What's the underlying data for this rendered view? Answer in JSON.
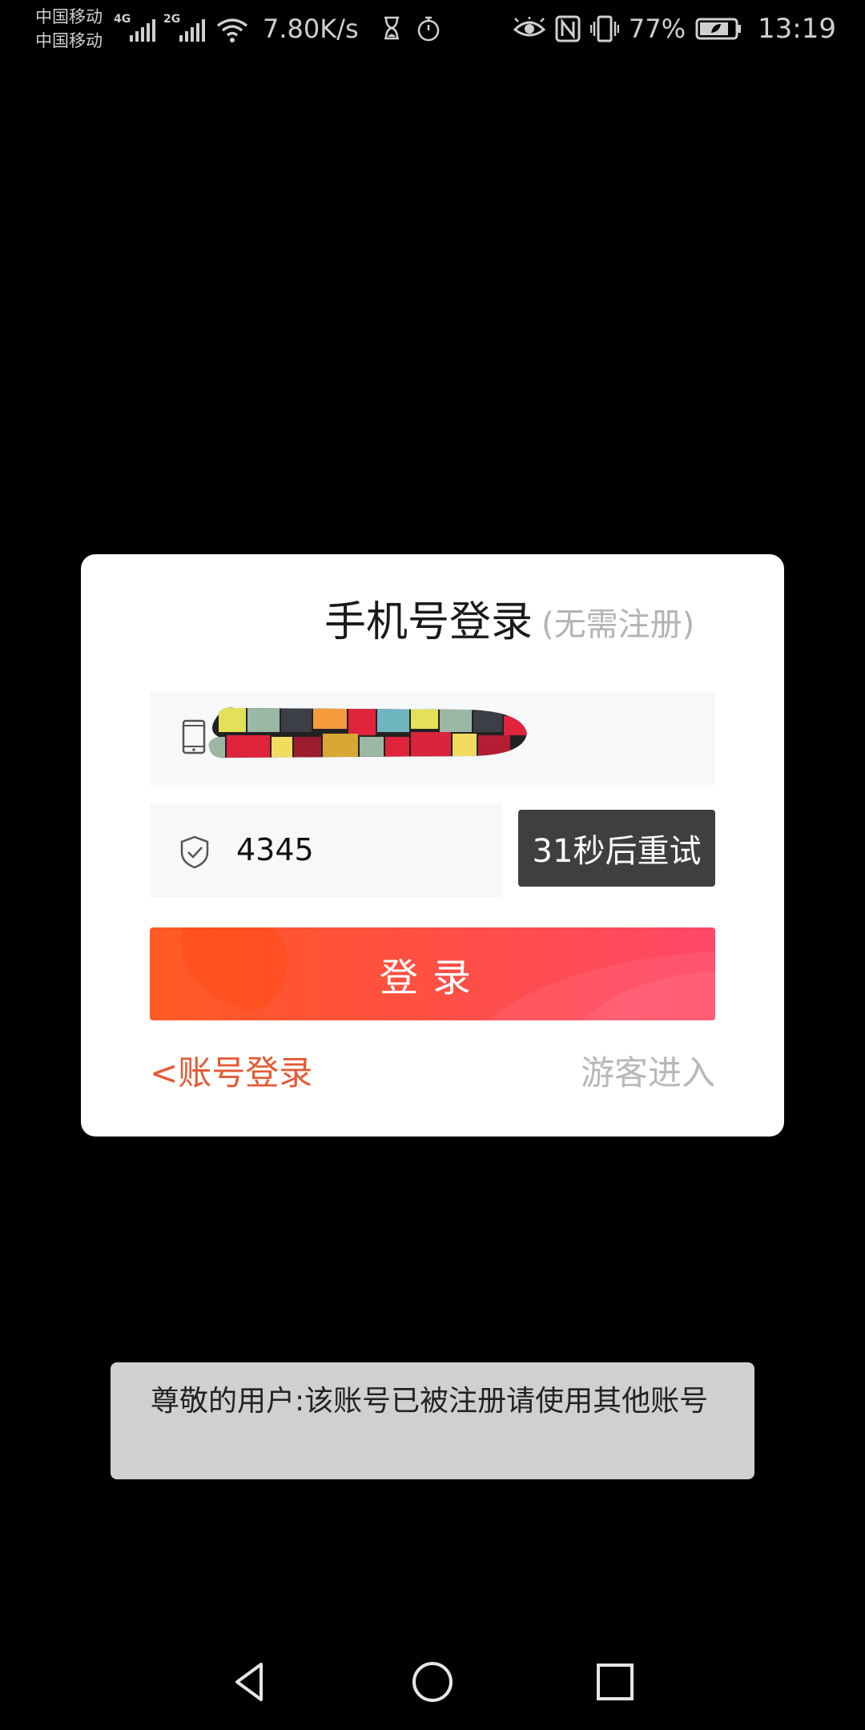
{
  "status_bar": {
    "carrier_1": "中国移动",
    "carrier_2": "中国移动",
    "sim1_network": "4G",
    "sim2_network": "2G",
    "net_speed": "7.80K/s",
    "battery_percent": "77%",
    "time": "13:19",
    "icons": [
      "signal-icon",
      "signal-icon",
      "wifi-icon",
      "hourglass-icon",
      "stopwatch-icon",
      "eye-icon",
      "nfc-icon",
      "vibrate-icon",
      "battery-icon"
    ]
  },
  "dialog": {
    "title": "手机号登录",
    "subtitle": "(无需注册)",
    "phone_field": {
      "icon": "phone-icon",
      "value": ""
    },
    "code_field": {
      "icon": "shield-check-icon",
      "value": "4345"
    },
    "retry_button": "31秒后重试",
    "login_button": "登录",
    "account_login_link": "<账号登录",
    "guest_link": "游客进入"
  },
  "toast": {
    "message": "尊敬的用户:该账号已被注册请使用其他账号"
  },
  "nav_bar": {
    "icons": [
      "back-icon",
      "home-icon",
      "recents-icon"
    ]
  },
  "colors": {
    "accent_orange": "#e45a35",
    "login_gradient_start": "#ff5a24",
    "login_gradient_end": "#ff4868",
    "retry_bg": "#3f3f3f",
    "toast_bg": "#d0d0d0"
  }
}
